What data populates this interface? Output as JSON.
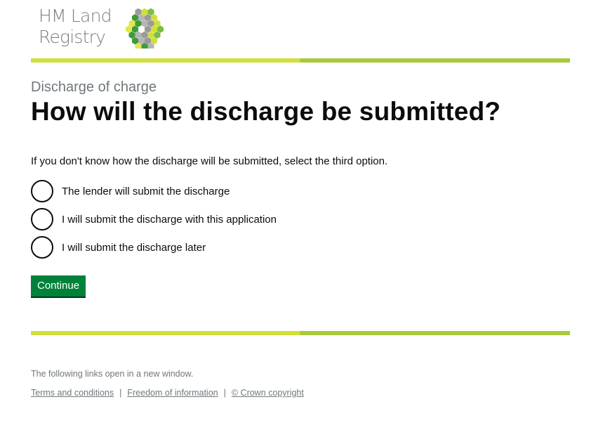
{
  "header": {
    "logo_line1": "HM Land",
    "logo_line2": "Registry",
    "logo_icon": "hm-land-registry-hexagon-logo",
    "colors": {
      "bar_light": "#cfe03a",
      "bar_dark": "#a9c93a"
    }
  },
  "main": {
    "caption": "Discharge of charge",
    "title": "How will the discharge be submitted?",
    "hint": "If you don't know how the discharge will be submitted, select the third option.",
    "options": [
      {
        "label": "The lender will submit the discharge"
      },
      {
        "label": "I will submit the discharge with this application"
      },
      {
        "label": "I will submit the discharge later"
      }
    ],
    "continue_label": "Continue",
    "colors": {
      "button": "#00823b"
    }
  },
  "footer": {
    "note": "The following links open in a new window.",
    "links": [
      {
        "label": "Terms and conditions"
      },
      {
        "label": "Freedom of information"
      },
      {
        "label": "© Crown copyright"
      }
    ],
    "separator": "|"
  }
}
